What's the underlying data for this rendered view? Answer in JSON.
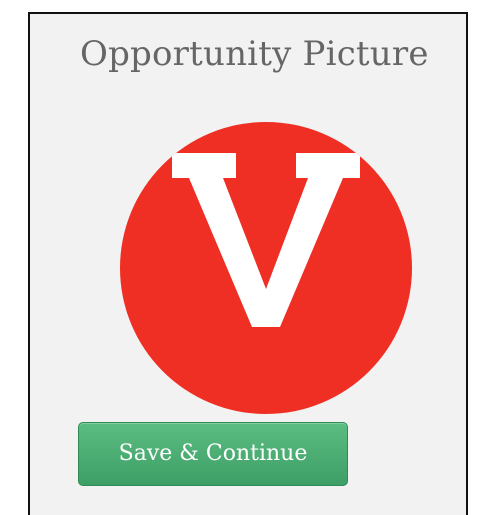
{
  "section": {
    "title": "Opportunity Picture"
  },
  "picture": {
    "letter": "V",
    "circle_color": "#ef2e24",
    "letter_color": "#ffffff"
  },
  "actions": {
    "save_label": "Save & Continue",
    "button_color": "#4cae74"
  }
}
